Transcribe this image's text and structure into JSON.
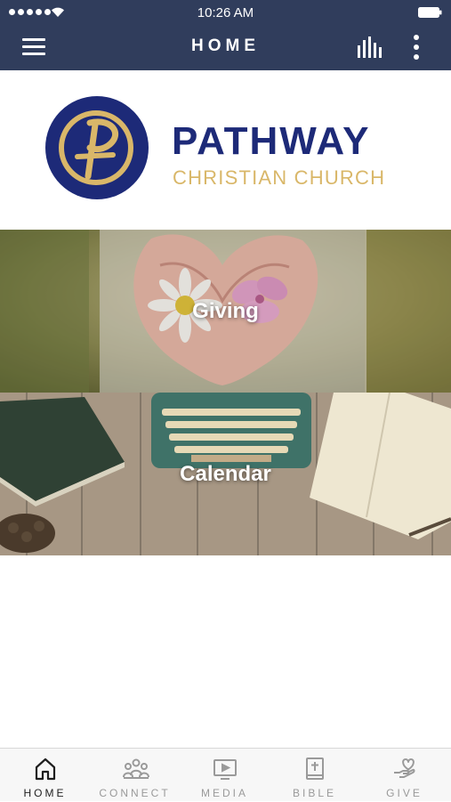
{
  "status_bar": {
    "time": "10:26 AM"
  },
  "header": {
    "title": "HOME"
  },
  "logo": {
    "name": "PATHWAY",
    "subtitle": "CHRISTIAN CHURCH"
  },
  "tiles": [
    {
      "label": "Giving"
    },
    {
      "label": "Calendar"
    }
  ],
  "bottom_nav": {
    "items": [
      {
        "label": "HOME",
        "icon": "home-icon",
        "active": true
      },
      {
        "label": "CONNECT",
        "icon": "people-icon",
        "active": false
      },
      {
        "label": "MEDIA",
        "icon": "play-screen-icon",
        "active": false
      },
      {
        "label": "BIBLE",
        "icon": "bible-icon",
        "active": false
      },
      {
        "label": "GIVE",
        "icon": "give-heart-icon",
        "active": false
      }
    ]
  },
  "colors": {
    "header_bg": "#303d5c",
    "brand_navy": "#1d2a78",
    "brand_gold": "#d9b769",
    "nav_active": "#1f1f1f",
    "nav_inactive": "#9a9a9a"
  }
}
